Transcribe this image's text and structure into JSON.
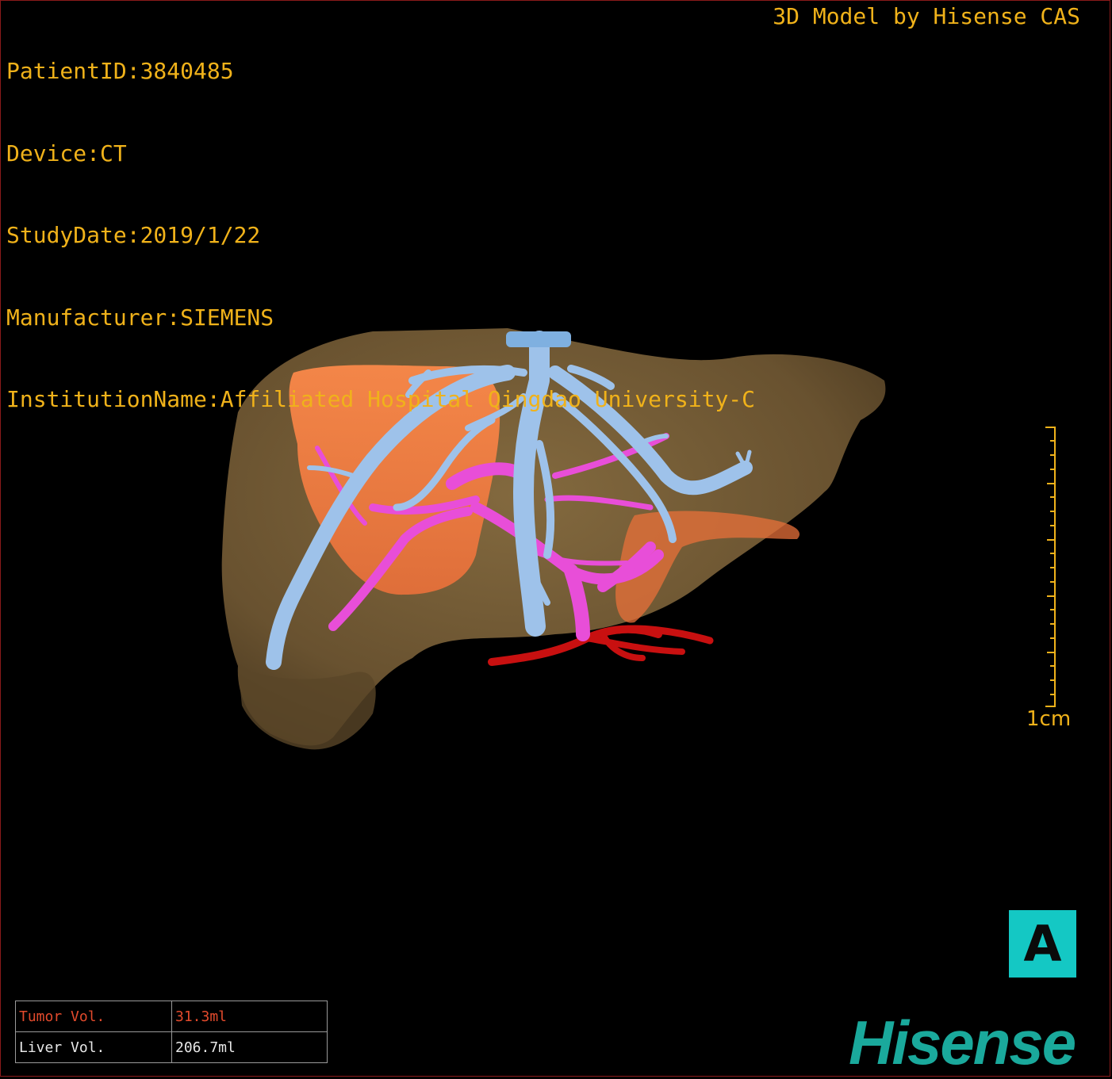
{
  "patient_info": [
    "PatientID:3840485",
    "Device:CT",
    "StudyDate:2019/1/22",
    "Manufacturer:SIEMENS",
    "InstitutionName:Affiliated Hospital Qingdao University-C"
  ],
  "credit": "3D Model by Hisense CAS",
  "scale_bar": {
    "label": "1cm"
  },
  "orientation": {
    "label": "A"
  },
  "volumes": [
    {
      "label": "Tumor Vol.",
      "value": "31.3ml"
    },
    {
      "label": "Liver Vol.",
      "value": "206.7ml"
    }
  ],
  "brand": "Hisense",
  "colors": {
    "text": "#f0b21a",
    "liver": "#7a6238",
    "tumor": "#ff7a3a",
    "hepatic_vein": "#9ec2ea",
    "portal_vein": "#e84ed8",
    "artery": "#c81010",
    "orientation_button": "#14c8c4",
    "brand": "#1aa99c"
  }
}
